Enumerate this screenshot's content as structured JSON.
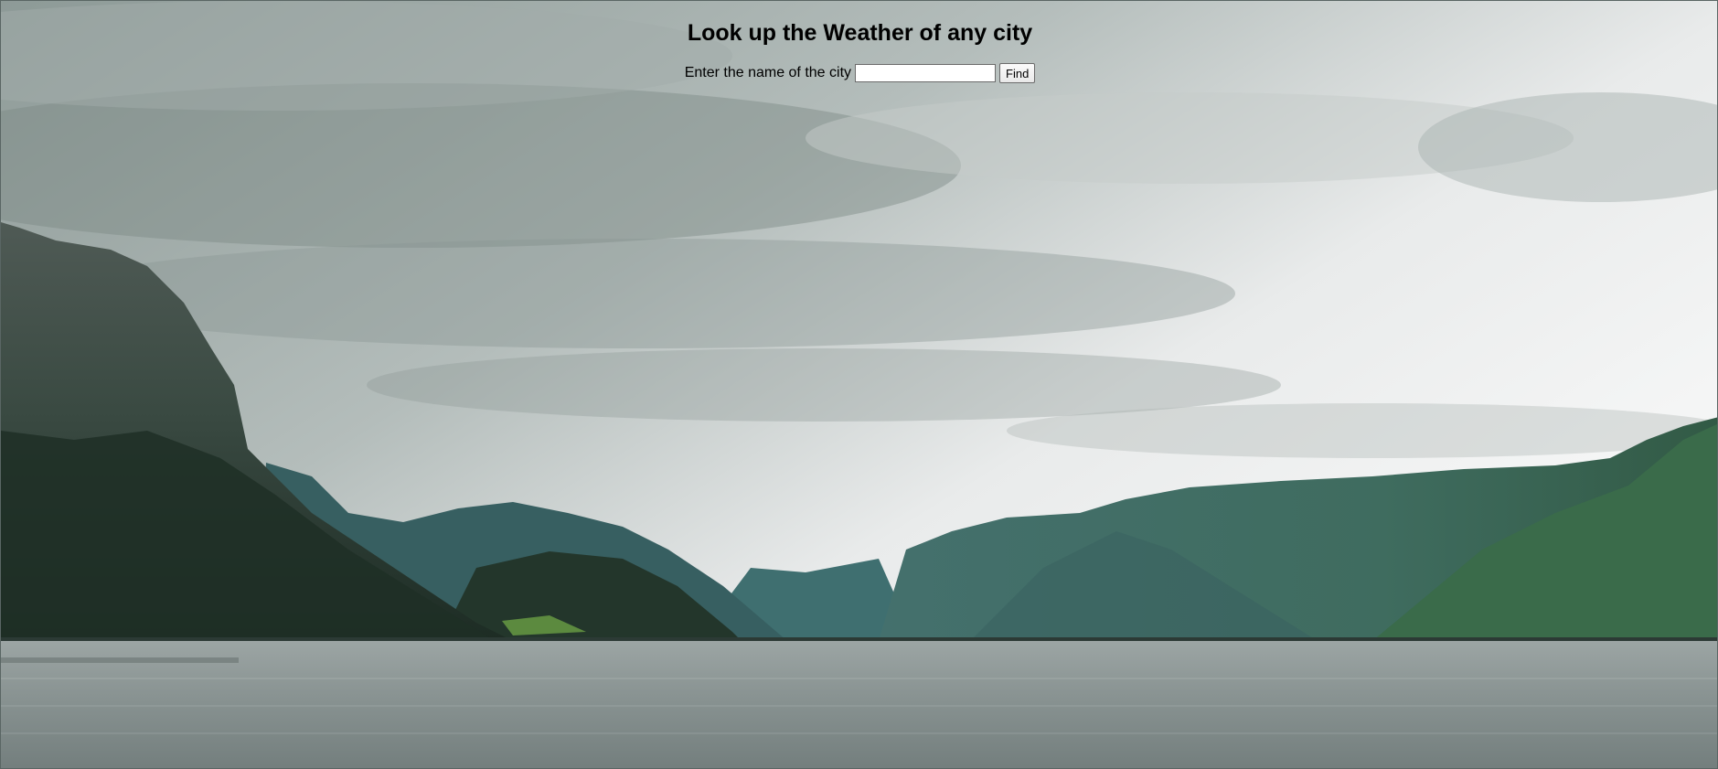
{
  "page": {
    "title": "Look up the Weather of any city",
    "prompt_label": "Enter the name of the city",
    "city_input": {
      "value": "",
      "placeholder": ""
    },
    "find_label": "Find"
  },
  "background": {
    "scene": "fjord-landscape",
    "colors": {
      "sky_top": "#9aa6a3",
      "sky_bright": "#e8eaea",
      "mountain_dark": "#24352f",
      "mountain_teal": "#3e6967",
      "water": "#8e9898"
    }
  }
}
